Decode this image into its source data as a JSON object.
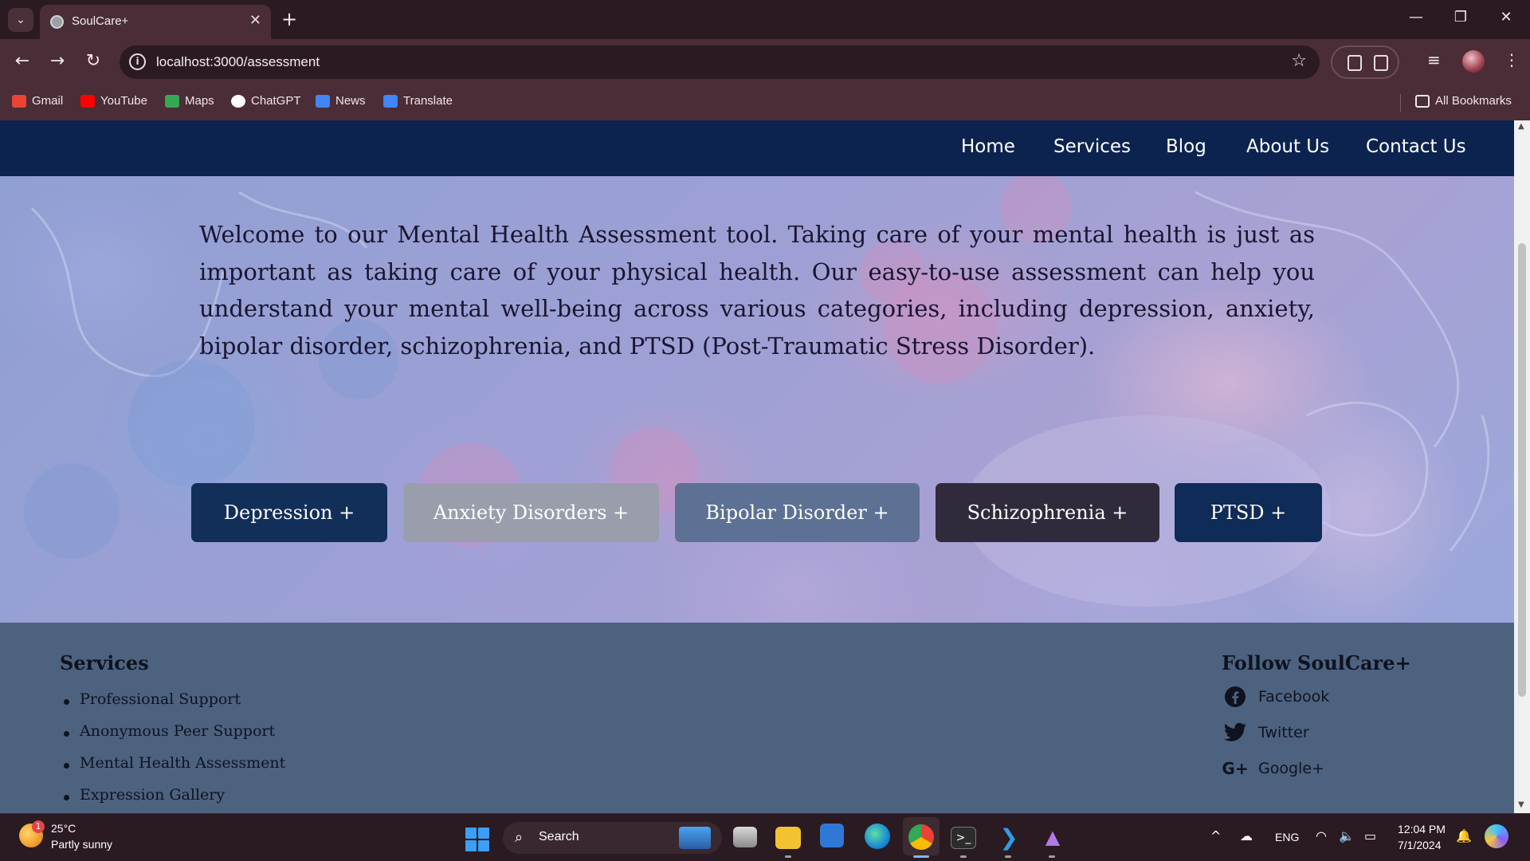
{
  "browser": {
    "tab_title": "SoulCare+",
    "url": "localhost:3000/assessment",
    "bookmarks": [
      {
        "label": "Gmail",
        "icon": "gmail-icon",
        "color": "#ea4335"
      },
      {
        "label": "YouTube",
        "icon": "youtube-icon",
        "color": "#ff0000"
      },
      {
        "label": "Maps",
        "icon": "maps-icon",
        "color": "#34a853"
      },
      {
        "label": "ChatGPT",
        "icon": "chatgpt-icon",
        "color": "#ffffff"
      },
      {
        "label": "News",
        "icon": "news-icon",
        "color": "#4285f4"
      },
      {
        "label": "Translate",
        "icon": "translate-icon",
        "color": "#4285f4"
      }
    ],
    "all_bookmarks_label": "All Bookmarks"
  },
  "site": {
    "nav": [
      "Home",
      "Services",
      "Blog",
      "About Us",
      "Contact Us"
    ],
    "intro": "Welcome to our Mental Health Assessment tool. Taking care of your mental health is just as important as taking care of your physical health. Our easy-to-use assessment can help you understand your mental well-being across various categories, including depression, anxiety, bipolar disorder, schizophrenia, and PTSD (Post-Traumatic Stress Disorder).",
    "categories": [
      {
        "label": "Depression +",
        "color": "#122f5a"
      },
      {
        "label": "Anxiety Disorders +",
        "color": "#9a9dab"
      },
      {
        "label": "Bipolar Disorder +",
        "color": "#5d7194"
      },
      {
        "label": "Schizophrenia +",
        "color": "#302a3c"
      },
      {
        "label": "PTSD +",
        "color": "#0f2b57"
      }
    ],
    "footer": {
      "services_title": "Services",
      "services": [
        "Professional Support",
        "Anonymous Peer Support",
        "Mental Health Assessment",
        "Expression Gallery"
      ],
      "follow_title": "Follow SoulCare+",
      "social": [
        {
          "label": "Facebook",
          "icon": "facebook-icon"
        },
        {
          "label": "Twitter",
          "icon": "twitter-icon"
        },
        {
          "label": "Google+",
          "icon": "google-plus-icon"
        }
      ]
    }
  },
  "taskbar": {
    "weather_badge": "1",
    "temperature": "25°C",
    "weather": "Partly sunny",
    "search_label": "Search",
    "language": "ENG",
    "time": "12:04 PM",
    "date": "7/1/2024"
  }
}
